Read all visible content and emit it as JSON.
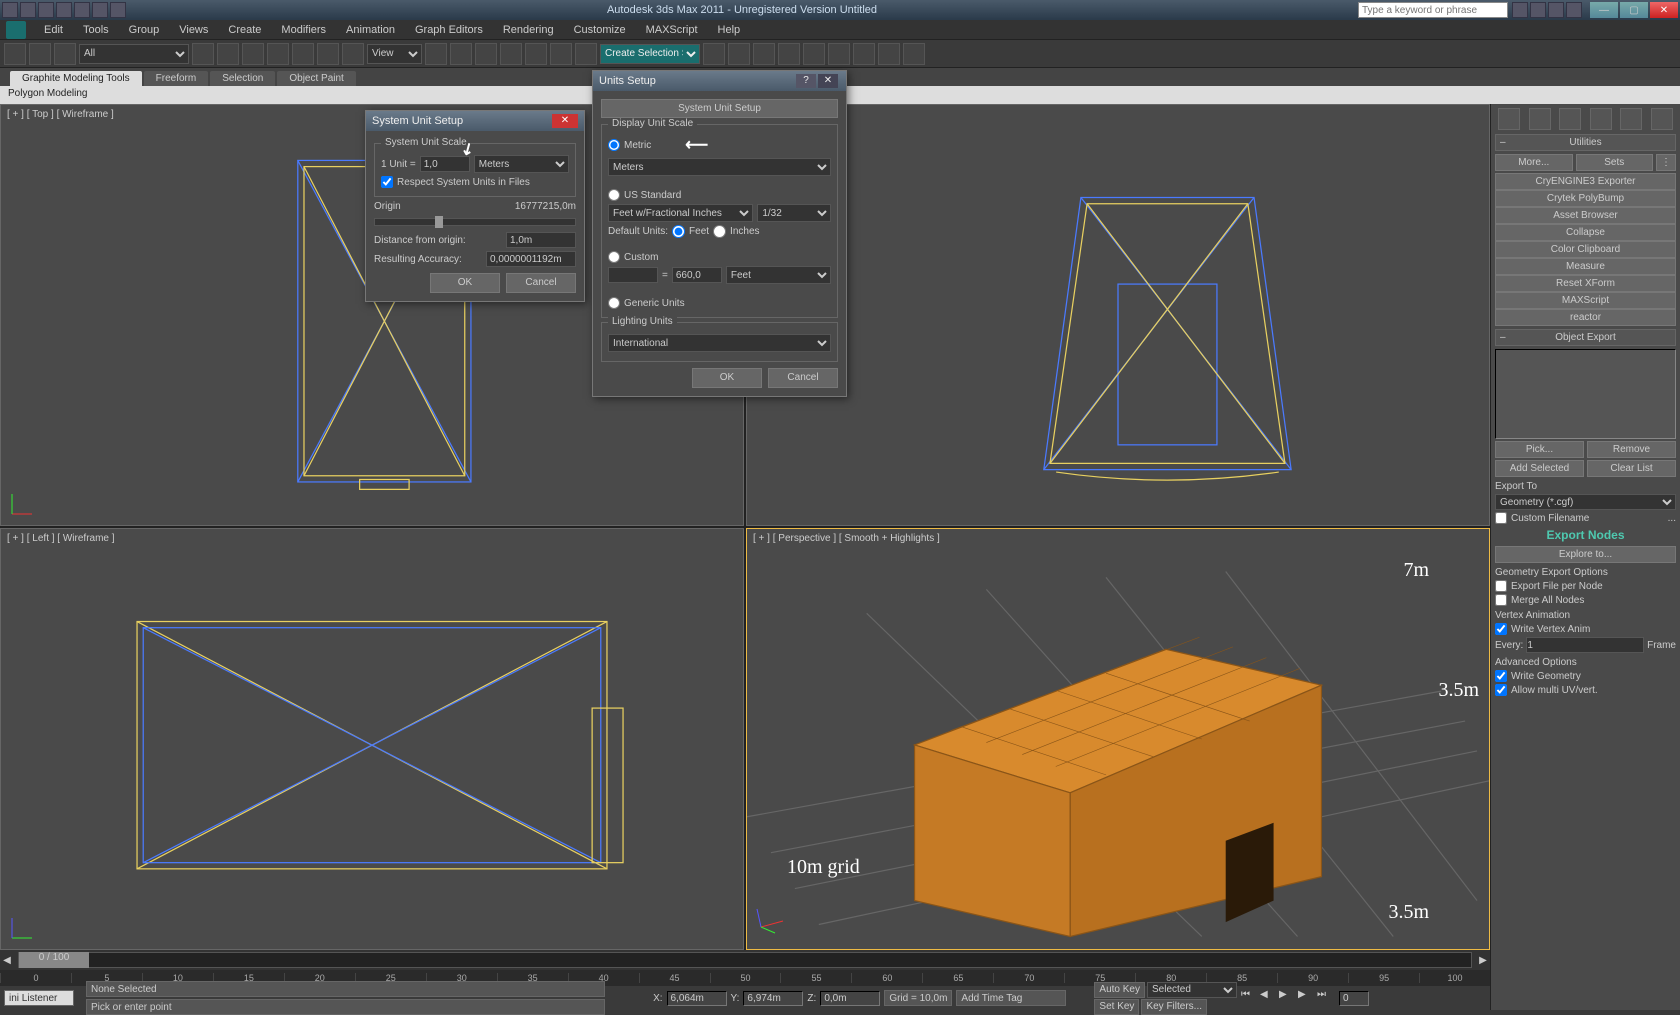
{
  "app": {
    "title": "Autodesk 3ds Max 2011  -  Unregistered Version    Untitled",
    "search_placeholder": "Type a keyword or phrase"
  },
  "menu": [
    "Edit",
    "Tools",
    "Group",
    "Views",
    "Create",
    "Modifiers",
    "Animation",
    "Graph Editors",
    "Rendering",
    "Customize",
    "MAXScript",
    "Help"
  ],
  "toolbar": {
    "filter_all": "All",
    "view": "View",
    "selset": "Create Selection Se"
  },
  "ribbon": {
    "tabs": [
      "Graphite Modeling Tools",
      "Freeform",
      "Selection",
      "Object Paint"
    ],
    "sub": "Polygon Modeling"
  },
  "viewports": {
    "top": "[ + ] [ Top ] [ Wireframe ]",
    "front": "",
    "left": "[ + ] [ Left ] [ Wireframe ]",
    "persp": "[ + ] [ Perspective ] [ Smooth + Highlights ]"
  },
  "annotations": {
    "dim_w": "7m",
    "dim_h": "3.5m",
    "dim_d": "3.5m",
    "grid": "10m grid"
  },
  "sys_unit_dialog": {
    "title": "System Unit Setup",
    "group": "System Unit Scale",
    "unit_label": "1 Unit =",
    "unit_value": "1,0",
    "unit_type": "Meters",
    "respect": "Respect System Units in Files",
    "origin_label": "Origin",
    "origin_value": "16777215,0m",
    "dist_label": "Distance from origin:",
    "dist_value": "1,0m",
    "acc_label": "Resulting Accuracy:",
    "acc_value": "0,0000001192m",
    "ok": "OK",
    "cancel": "Cancel"
  },
  "units_dialog": {
    "title": "Units Setup",
    "sys_btn": "System Unit Setup",
    "display_group": "Display Unit Scale",
    "metric": "Metric",
    "metric_sel": "Meters",
    "us": "US Standard",
    "us_sel": "Feet w/Fractional Inches",
    "us_frac": "1/32",
    "default_units": "Default Units:",
    "feet": "Feet",
    "inches": "Inches",
    "custom": "Custom",
    "custom_eq": "=",
    "custom_val": "660,0",
    "custom_unit": "Feet",
    "generic": "Generic Units",
    "lighting_group": "Lighting Units",
    "lighting_sel": "International",
    "ok": "OK",
    "cancel": "Cancel"
  },
  "cmdpanel": {
    "rollouts": {
      "utilities": "Utilities",
      "more": "More...",
      "sets": "Sets",
      "btns": [
        "CryENGINE3 Exporter",
        "Crytek PolyBump",
        "Asset Browser",
        "Collapse",
        "Color Clipboard",
        "Measure",
        "Reset XForm",
        "MAXScript",
        "reactor"
      ],
      "object_export": "Object Export",
      "pick": "Pick...",
      "remove": "Remove",
      "add_selected": "Add Selected",
      "clear_list": "Clear List",
      "export_to": "Export To",
      "export_sel": "Geometry (*.cgf)",
      "custom_filename": "Custom Filename",
      "export_nodes": "Export Nodes",
      "explore": "Explore to...",
      "geom_opts": "Geometry Export Options",
      "export_per_node": "Export File per Node",
      "merge_nodes": "Merge All Nodes",
      "vertex_anim": "Vertex Animation",
      "write_vertex": "Write Vertex Anim",
      "every": "Every:",
      "every_val": "1",
      "frame": "Frame",
      "adv": "Advanced Options",
      "write_geom": "Write Geometry",
      "allow_multi": "Allow multi UV/vert."
    }
  },
  "timeline": {
    "pos": "0 / 100",
    "ticks": [
      "0",
      "5",
      "10",
      "15",
      "20",
      "25",
      "30",
      "35",
      "40",
      "45",
      "50",
      "55",
      "60",
      "65",
      "70",
      "75",
      "80",
      "85",
      "90",
      "95",
      "100"
    ]
  },
  "status": {
    "mini": "ini Listener",
    "none_selected": "None Selected",
    "prompt": "Pick or enter point",
    "x": "6,064m",
    "y": "6,974m",
    "z": "0,0m",
    "grid": "Grid = 10,0m",
    "auto_key": "Auto Key",
    "sel_list": "Selected",
    "set_key": "Set Key",
    "key_filters": "Key Filters...",
    "add_time_tag": "Add Time Tag",
    "frame0": "0"
  }
}
